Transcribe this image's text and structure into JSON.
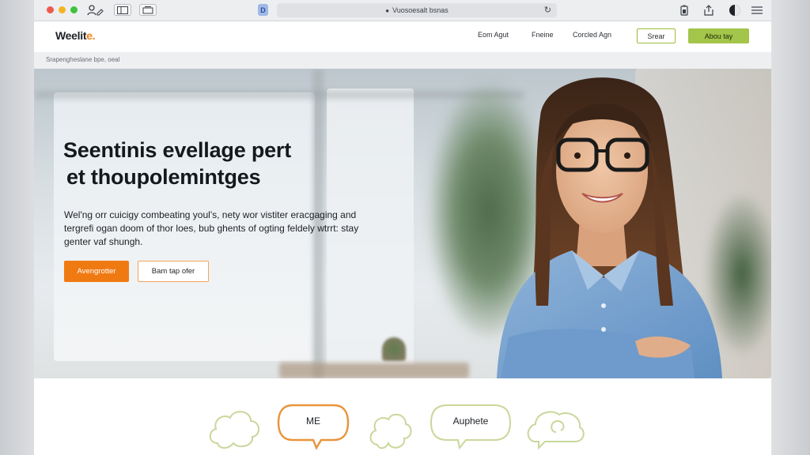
{
  "browser": {
    "address": "Vuosoesalt bsnas",
    "icons": [
      "close-dot",
      "minimize-dot",
      "maximize-dot",
      "person-edit-icon",
      "sidebar-icon",
      "tab-icon",
      "favicon",
      "lock-icon",
      "reload-icon",
      "share-icon",
      "battery-icon",
      "profile-icon",
      "menu-icon"
    ]
  },
  "site": {
    "logo_main": "Weelit",
    "logo_accent": "e.",
    "nav": {
      "links": [
        "Eom Agut",
        "Fneine",
        "Corcled Agn"
      ],
      "button_outline": "Srear",
      "button_fill": "Abou tay"
    },
    "breadcrumb": "Srapengheslane bpe, oeal",
    "hero": {
      "headline_line1": "Seentinis evellage pert",
      "headline_line2": "et thoupolemintges",
      "body": "Wel'ng orr cuicigy combeating youl's, nety wor vistiter eracgaging and tergrefi ogan doom of thor loes, bub ghents of ogting feldely wtrrt: stay genter vaf shungh.",
      "primary_button": "Avengrotter",
      "secondary_button": "Bam tap ofer"
    },
    "features": [
      {
        "label": "",
        "icon": "cloud-bubble-icon"
      },
      {
        "label": "ME",
        "icon": "speech-bubble-orange-icon"
      },
      {
        "label": "",
        "icon": "cloud-bubble-small-icon"
      },
      {
        "label": "Auphete",
        "icon": "speech-bubble-green-icon"
      },
      {
        "label": "",
        "icon": "chat-swirl-icon"
      }
    ]
  },
  "colors": {
    "accent_orange": "#f07a12",
    "accent_green": "#a3c54a",
    "outline_green": "#c9d79b",
    "outline_orange": "#e9953d"
  }
}
